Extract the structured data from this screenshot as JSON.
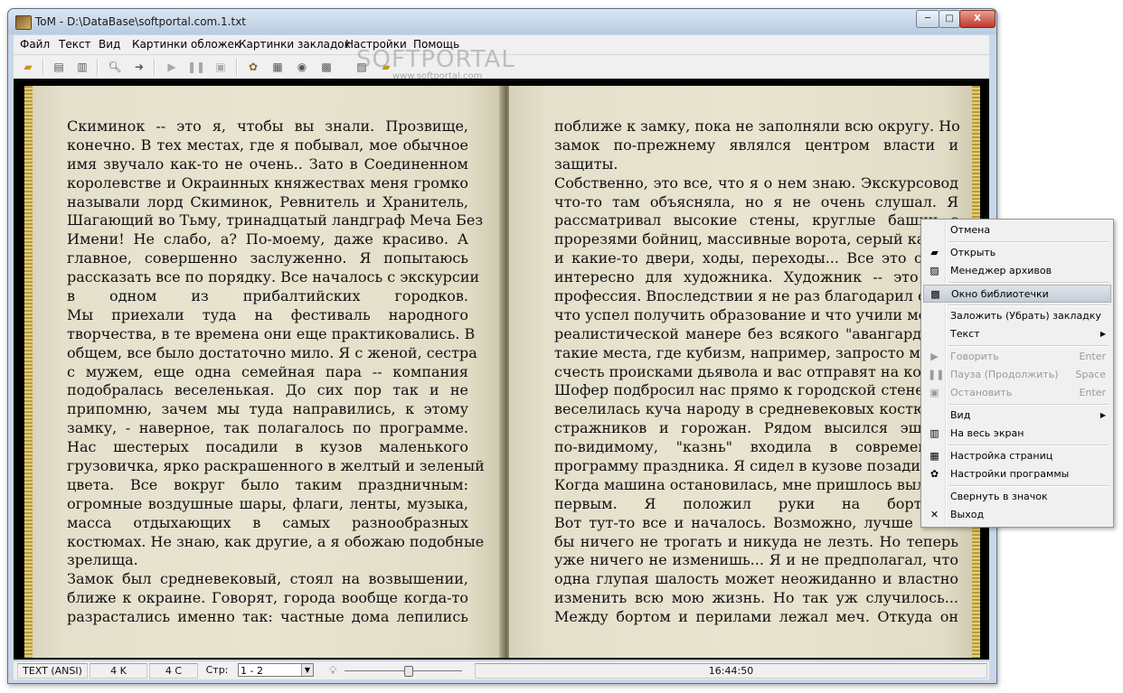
{
  "window": {
    "title": "ToM - D:\\DataBase\\softportal.com.1.txt",
    "min_label": "─",
    "max_label": "□",
    "close_label": "X"
  },
  "menu": [
    "Файл",
    "Текст",
    "Вид",
    "Картинки обложек",
    "Картинки закладок",
    "Настройки",
    "Помощь"
  ],
  "watermark": {
    "big": "SOFTPORTAL",
    "small": "www.softportal.com"
  },
  "book": {
    "left_lines": [
      "Скиминок -- это я, чтобы вы знали. Прозвище,",
      "конечно. В тех местах, где я побывал, мое обычное",
      "имя звучало как-то не очень.. Зато в Соединенном",
      "королевстве и Окраинных княжествах меня громко",
      "называли лорд Скиминок, Ревнитель и Хранитель,",
      "Шагающий во Тьму, тринадцатый ландграф Меча Без",
      "Имени! Не слабо, а? По-моему, даже красиво. А",
      "главное, совершенно заслуженно. Я попытаюсь",
      "рассказать все по порядку. Все началось с экскурсии",
      "в одном из прибалтийских городков.",
      "  Мы приехали туда на фестиваль народного",
      "творчества, в те времена они еще практиковались. В",
      "общем, все было достаточно мило. Я с женой, сестра",
      "с мужем, еще одна семейная пара -- компания",
      "подобралась веселенькая. До сих пор так и не",
      "припомню, зачем мы туда направились, к этому",
      "замку, - наверное, так полагалось по программе.",
      "  Нас шестерых посадили в кузов маленького",
      "грузовичка, ярко раскрашенного в желтый и зеленый",
      "цвета. Все вокруг было таким праздничным:",
      "огромные воздушные шары, флаги, ленты, музыка,",
      "масса отдыхающих в самых разнообразных",
      "костюмах. Не знаю, как другие, а я обожаю подобные",
      "зрелища.",
      "  Замок был средневековый, стоял на возвышении,",
      "ближе к окраине. Говорят, города вообще когда-то",
      "разрастались именно так: частные дома лепились"
    ],
    "right_lines": [
      "поближе к замку, пока не заполняли всю округу. Но",
      "замок по-прежнему являлся центром власти и",
      "защиты.",
      "  Собственно, это все, что я о нем знаю. Экскурсовод",
      "что-то там объясняла, но я не очень слушал. Я",
      "рассматривал высокие стены, круглые башни с",
      "прорезями бойниц, массивные ворота, серый камень",
      "и какие-то двери, ходы, переходы... Все это очень",
      "интересно для художника. Художник -- это моя",
      "профессия. Впоследствии я не раз благодарил судьбу",
      "что успел получить образование и что учили меня в",
      "реалистической манере без всякого \"авангарда\". В",
      "такие места, где кубизм, например, запросто может",
      "счесть происками дьявола и вас отправят на костер.",
      "  Шофер подбросил нас прямо к городской стене, где",
      "веселилась куча народу в средневековых костюмах,",
      "стражников и горожан. Рядом высился эшафот",
      "по-видимому, \"казнь\" входила в современную",
      "программу праздника. Я сидел в кузове позади всех.",
      "Когда машина остановилась, мне пришлось вылезать",
      "первым. Я положил руки на борт и",
      "  Вот тут-то все и началось. Возможно, лучше было",
      "бы ничего не трогать и никуда не лезть. Но теперь",
      "уже ничего не изменишь... Я и не предполагал, что",
      "одна глупая шалость может неожиданно и властно",
      "изменить всю мою жизнь. Но так уж случилось...",
      "  Между бортом и перилами лежал меч. Откуда он"
    ]
  },
  "status": {
    "encoding": "TEXT (ANSI)",
    "size": "4 K",
    "chars": "4 C",
    "page_label": "Стр:",
    "page_value": "1 - 2",
    "time": "16:44:50",
    "volume_level": 0.53
  },
  "context_menu": {
    "items": [
      {
        "label": "Отмена",
        "shortcut": "",
        "icon": "",
        "disabled": false
      },
      {
        "label": "Открыть",
        "shortcut": "",
        "icon": "open-folder-icon",
        "disabled": false
      },
      {
        "label": "Менеджер архивов",
        "shortcut": "",
        "icon": "archive-icon",
        "disabled": false
      },
      {
        "label": "Окно библиотечки",
        "shortcut": "",
        "icon": "library-icon",
        "disabled": false,
        "highlighted": true
      },
      {
        "label": "Заложить (Убрать) закладку",
        "shortcut": "",
        "icon": "",
        "disabled": false
      },
      {
        "label": "Текст",
        "shortcut": "",
        "icon": "",
        "disabled": false,
        "submenu": true
      },
      {
        "label": "Говорить",
        "shortcut": "Enter",
        "icon": "play-icon",
        "disabled": true
      },
      {
        "label": "Пауза (Продолжить)",
        "shortcut": "Space",
        "icon": "pause-icon",
        "disabled": true
      },
      {
        "label": "Остановить",
        "shortcut": "Enter",
        "icon": "stop-icon",
        "disabled": true
      },
      {
        "label": "Вид",
        "shortcut": "",
        "icon": "",
        "disabled": false,
        "submenu": true
      },
      {
        "label": "На весь экран",
        "shortcut": "",
        "icon": "fullscreen-icon",
        "disabled": false
      },
      {
        "label": "Настройка страниц",
        "shortcut": "",
        "icon": "page-setup-icon",
        "disabled": false
      },
      {
        "label": "Настройки программы",
        "shortcut": "",
        "icon": "settings-icon",
        "disabled": false
      },
      {
        "label": "Свернуть в значок",
        "shortcut": "",
        "icon": "",
        "disabled": false
      },
      {
        "label": "Выход",
        "shortcut": "",
        "icon": "exit-icon",
        "disabled": false
      }
    ]
  }
}
